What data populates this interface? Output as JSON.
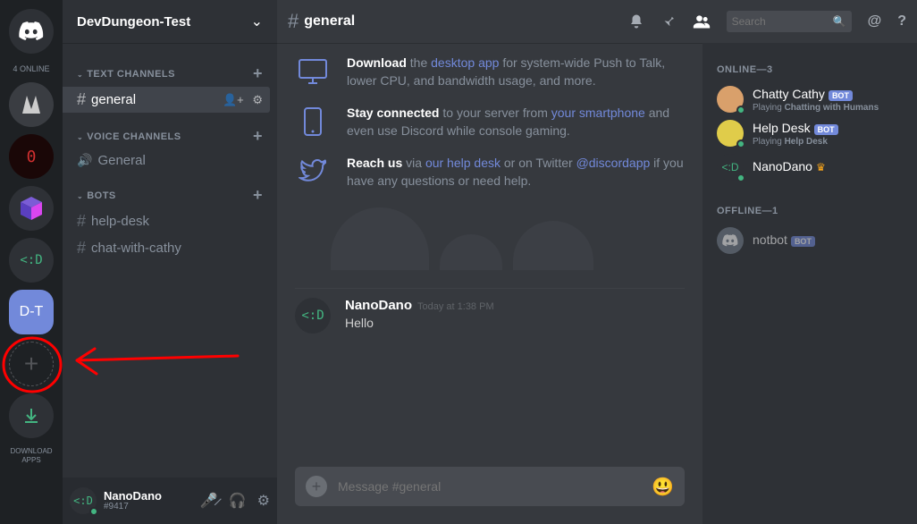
{
  "guilds": {
    "online_label": "4 ONLINE",
    "selected_label": "D-T",
    "download_label": "DOWNLOAD\nAPPS"
  },
  "server": {
    "name": "DevDungeon-Test",
    "text_channels_label": "TEXT CHANNELS",
    "voice_channels_label": "VOICE CHANNELS",
    "bots_label": "BOTS",
    "channels": {
      "general": "general",
      "voice_general": "General",
      "help_desk": "help-desk",
      "chat_with_cathy": "chat-with-cathy"
    }
  },
  "current_user": {
    "name": "NanoDano",
    "discriminator": "#9417",
    "avatar_text": "<:D"
  },
  "chat": {
    "channel_name": "general",
    "search_placeholder": "Search",
    "input_placeholder": "Message #general",
    "welcome": {
      "download_bold": "Download",
      "download_mid": " the ",
      "download_link": "desktop app",
      "download_rest": " for system-wide Push to Talk, lower CPU, and bandwidth usage, and more.",
      "stay_bold": "Stay connected",
      "stay_mid": " to your server from ",
      "stay_link": "your smartphone",
      "stay_rest": " and even use Discord while console gaming.",
      "reach_bold": "Reach us",
      "reach_mid": " via ",
      "reach_link1": "our help desk",
      "reach_mid2": " or on Twitter ",
      "reach_link2": "@discordapp",
      "reach_rest": " if you have any questions or need help."
    },
    "messages": [
      {
        "author": "NanoDano",
        "timestamp": "Today at 1:38 PM",
        "body": "Hello",
        "avatar_text": "<:D"
      }
    ]
  },
  "members": {
    "online_heading": "ONLINE—3",
    "offline_heading": "OFFLINE—1",
    "online": [
      {
        "name": "Chatty Cathy",
        "bot": true,
        "playing_prefix": "Playing ",
        "playing": "Chatting with Humans",
        "avatar_color": "#d9a06b"
      },
      {
        "name": "Help Desk",
        "bot": true,
        "playing_prefix": "Playing ",
        "playing": "Help Desk",
        "avatar_color": "#e0cc4a"
      },
      {
        "name": "NanoDano",
        "bot": false,
        "crown": true,
        "avatar_text": "<:D",
        "avatar_bg": "#2e3136",
        "avatar_fg": "#43b581"
      }
    ],
    "offline": [
      {
        "name": "notbot",
        "bot": true,
        "avatar_color": "#747f8d"
      }
    ]
  },
  "bot_label": "BOT"
}
